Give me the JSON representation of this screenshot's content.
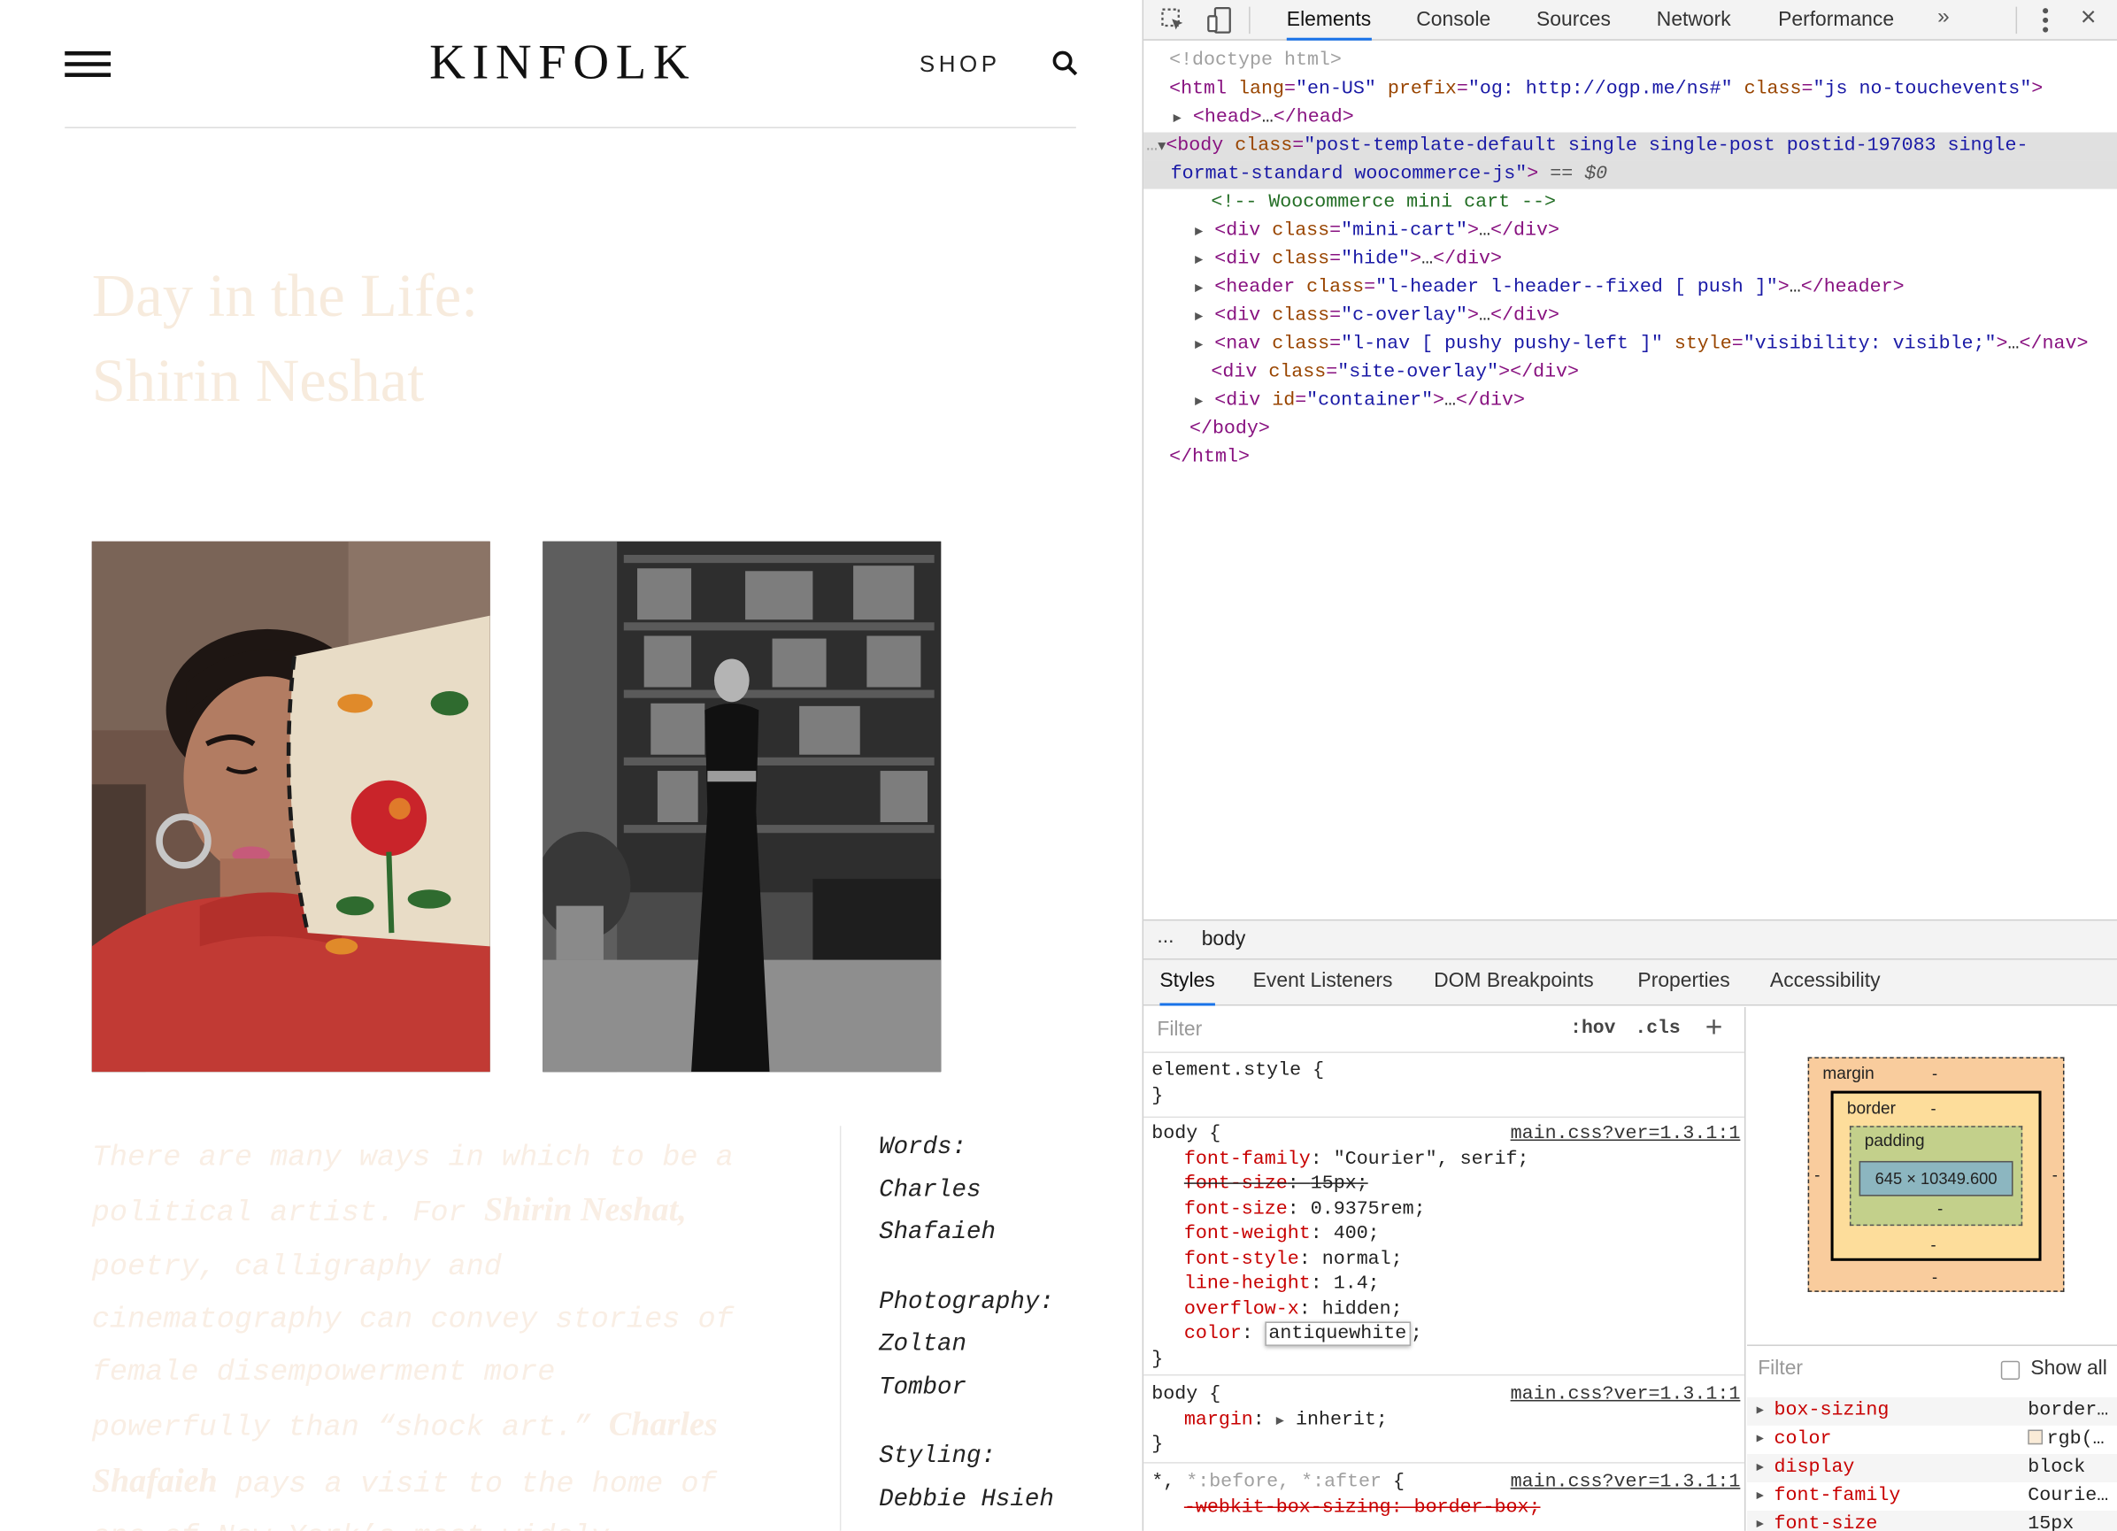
{
  "site": {
    "logo": "KINFOLK",
    "shop_label": "SHOP",
    "title_line1": "Day in the Life:",
    "title_line2": "Shirin Neshat",
    "body_lines": [
      {
        "pre": "There are many ways in which to be a",
        "bold": "",
        "post": ""
      },
      {
        "pre": "political artist. For ",
        "bold": "Shirin Neshat,",
        "post": ""
      },
      {
        "pre": "poetry, calligraphy and",
        "bold": "",
        "post": ""
      },
      {
        "pre": "cinematography can convey stories of",
        "bold": "",
        "post": ""
      },
      {
        "pre": "female disempowerment more",
        "bold": "",
        "post": ""
      },
      {
        "pre": "powerfully than “shock art.” ",
        "bold": "Charles",
        "post": ""
      },
      {
        "pre": "",
        "bold": "Shafaieh",
        "post": " pays a visit to the home of"
      },
      {
        "pre": "one of New York’s most widely",
        "bold": "",
        "post": ""
      }
    ],
    "credits": [
      {
        "role": "Words:",
        "names": [
          "Charles",
          "Shafaieh"
        ]
      },
      {
        "role": "Photography:",
        "names": [
          "Zoltan",
          "Tombor"
        ]
      },
      {
        "role": "Styling:",
        "names": [
          "Debbie Hsieh"
        ]
      }
    ]
  },
  "devtools": {
    "tabs": [
      "Elements",
      "Console",
      "Sources",
      "Network",
      "Performance"
    ],
    "active_tab": "Elements",
    "more_tabs": "»",
    "dom": {
      "doctype": "<!doctype html>",
      "html_open": {
        "tag": "html",
        "attrs": [
          [
            "lang",
            "en-US"
          ],
          [
            "prefix",
            "og: http://ogp.me/ns#"
          ],
          [
            "class",
            "js no-touchevents"
          ]
        ]
      },
      "head": "head",
      "body_class_1": "post-template-default single single-post postid-197083 single-",
      "body_class_2": "format-standard woocommerce-js",
      "eq0": "== $0",
      "comment": "<!-- Woocommerce mini cart -->",
      "children": [
        {
          "tag": "div",
          "attr": "class",
          "val": "mini-cart",
          "collapsed": true
        },
        {
          "tag": "div",
          "attr": "class",
          "val": "hide",
          "collapsed": true
        },
        {
          "tag": "header",
          "attr": "class",
          "val": "l-header l-header--fixed [ push ]",
          "collapsed": true
        },
        {
          "tag": "div",
          "attr": "class",
          "val": "c-overlay",
          "collapsed": true
        },
        {
          "tag": "nav",
          "attr": "class",
          "val": "l-nav [ pushy pushy-left ]",
          "attr2": "style",
          "val2": "visibility: visible;",
          "collapsed": true
        },
        {
          "tag": "div",
          "attr": "class",
          "val": "site-overlay",
          "collapsed": false
        },
        {
          "tag": "div",
          "attr": "id",
          "val": "container",
          "collapsed": true
        }
      ],
      "body_close": "</body>",
      "html_close": "</html>"
    },
    "breadcrumb": {
      "dots": "...",
      "current": "body"
    },
    "sub_tabs": [
      "Styles",
      "Event Listeners",
      "DOM Breakpoints",
      "Properties",
      "Accessibility"
    ],
    "styles": {
      "filter_placeholder": "Filter",
      "hov": ":hov",
      "cls": ".cls",
      "plus": "+",
      "element_style": "element.style {",
      "close_brace": "}",
      "rule1_selector": "body {",
      "rule1_source": "main.css?ver=1.3.1:1",
      "rule1_props": [
        {
          "name": "font-family",
          "value": "\"Courier\", serif;",
          "struck": false
        },
        {
          "name": "font-size",
          "value": "15px;",
          "struck": true
        },
        {
          "name": "font-size",
          "value": "0.9375rem;",
          "struck": false
        },
        {
          "name": "font-weight",
          "value": "400;",
          "struck": false
        },
        {
          "name": "font-style",
          "value": "normal;",
          "struck": false
        },
        {
          "name": "line-height",
          "value": "1.4;",
          "struck": false
        },
        {
          "name": "overflow-x",
          "value": "hidden;",
          "struck": false
        }
      ],
      "rule1_color_name": "color",
      "rule1_color_value": "antiquewhite",
      "rule2_selector": "body {",
      "rule2_source": "main.css?ver=1.3.1:1",
      "rule2_prop": "margin",
      "rule2_value": "inherit;",
      "rule3_selector_a": "*, ",
      "rule3_selector_b": "*:before, *:after",
      "rule3_selector_c": " {",
      "rule3_source": "main.css?ver=1.3.1:1",
      "rule3_prop": "-webkit-box-sizing: border-box;"
    },
    "box_model": {
      "margin_label": "margin",
      "border_label": "border",
      "padding_label": "padding",
      "dash": "-",
      "content": "645 × 10349.600"
    },
    "computed": {
      "filter_placeholder": "Filter",
      "show_all": "Show all",
      "props": [
        {
          "name": "box-sizing",
          "value": "border…"
        },
        {
          "name": "color",
          "value": "rgb(…",
          "swatch": "#faebd7"
        },
        {
          "name": "display",
          "value": "block"
        },
        {
          "name": "font-family",
          "value": "Courie…"
        },
        {
          "name": "font-size",
          "value": "15px"
        }
      ]
    }
  }
}
